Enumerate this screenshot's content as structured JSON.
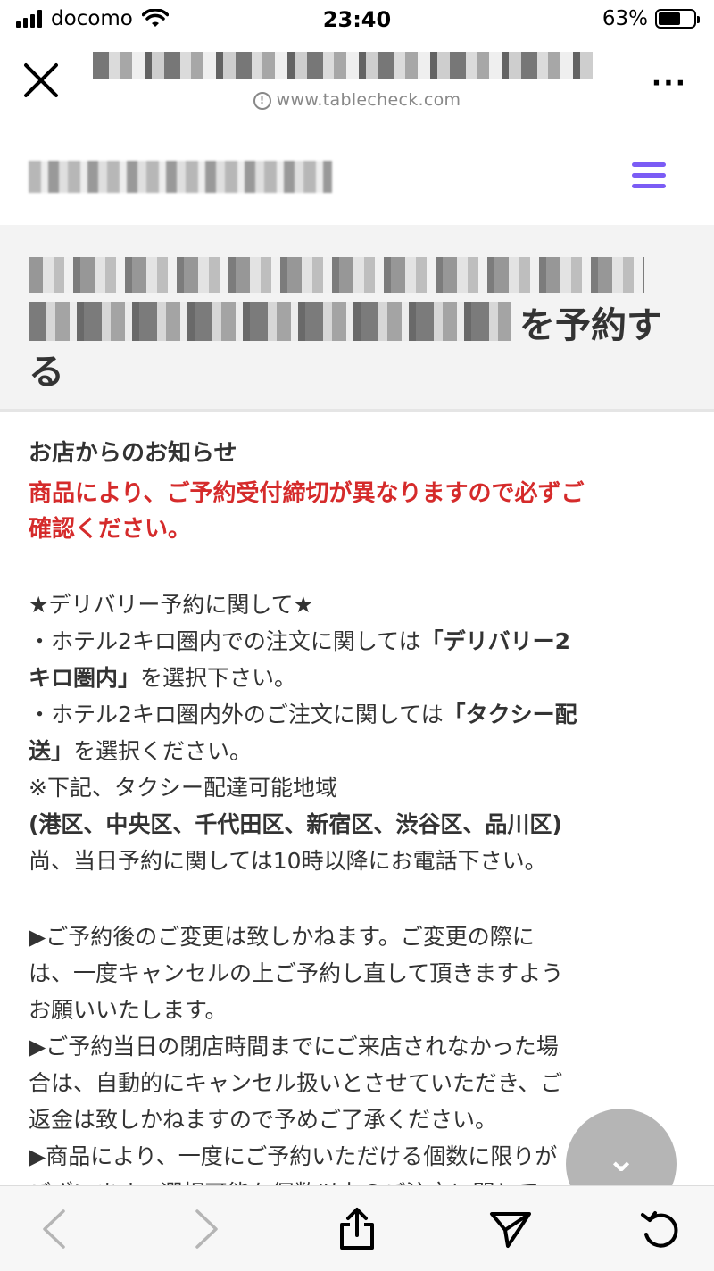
{
  "status_bar": {
    "carrier": "docomo",
    "time": "23:40",
    "battery_percent": "63%",
    "battery_level": 0.63
  },
  "browser": {
    "url": "www.tablecheck.com"
  },
  "hero": {
    "title_suffix_line2": "を予約す",
    "title_line3": "る"
  },
  "notice": {
    "heading": "お店からのお知らせ",
    "alert_line1": "商品により、ご予約受付締切が異なりますので必ずご",
    "alert_line2": "確認ください。",
    "delivery_heading": "★デリバリー予約に関して★",
    "l1_a": "・ホテル2キロ圏内での注文に関しては",
    "l1_b": "「デリバリー2",
    "l2_a": "キロ圏内」",
    "l2_b": "を選択下さい。",
    "l3_a": "・ホテル2キロ圏内外のご注文に関しては",
    "l3_b": "「タクシー配",
    "l4_a": "送」",
    "l4_b": "を選択ください。",
    "l5": "※下記、タクシー配達可能地域",
    "l6": "(港区、中央区、千代田区、新宿区、渋谷区、品川区)",
    "l7": "尚、当日予約に関しては10時以降にお電話下さい。",
    "p1": "▶ご予約後のご変更は致しかねます。ご変更の際に",
    "p2": "は、一度キャンセルの上ご予約し直して頂きますよう",
    "p3": "お願いいたします。",
    "p4": "▶ご予約当日の閉店時間までにご来店されなかった場",
    "p5": "合は、自動的にキャンセル扱いとさせていただき、ご",
    "p6": "返金は致しかねますので予めご了承ください。",
    "p7": "▶商品により、一度にご予約いただける個数に限りが",
    "p8": "ございます。選択可能な個数以上のご注文に関して"
  }
}
